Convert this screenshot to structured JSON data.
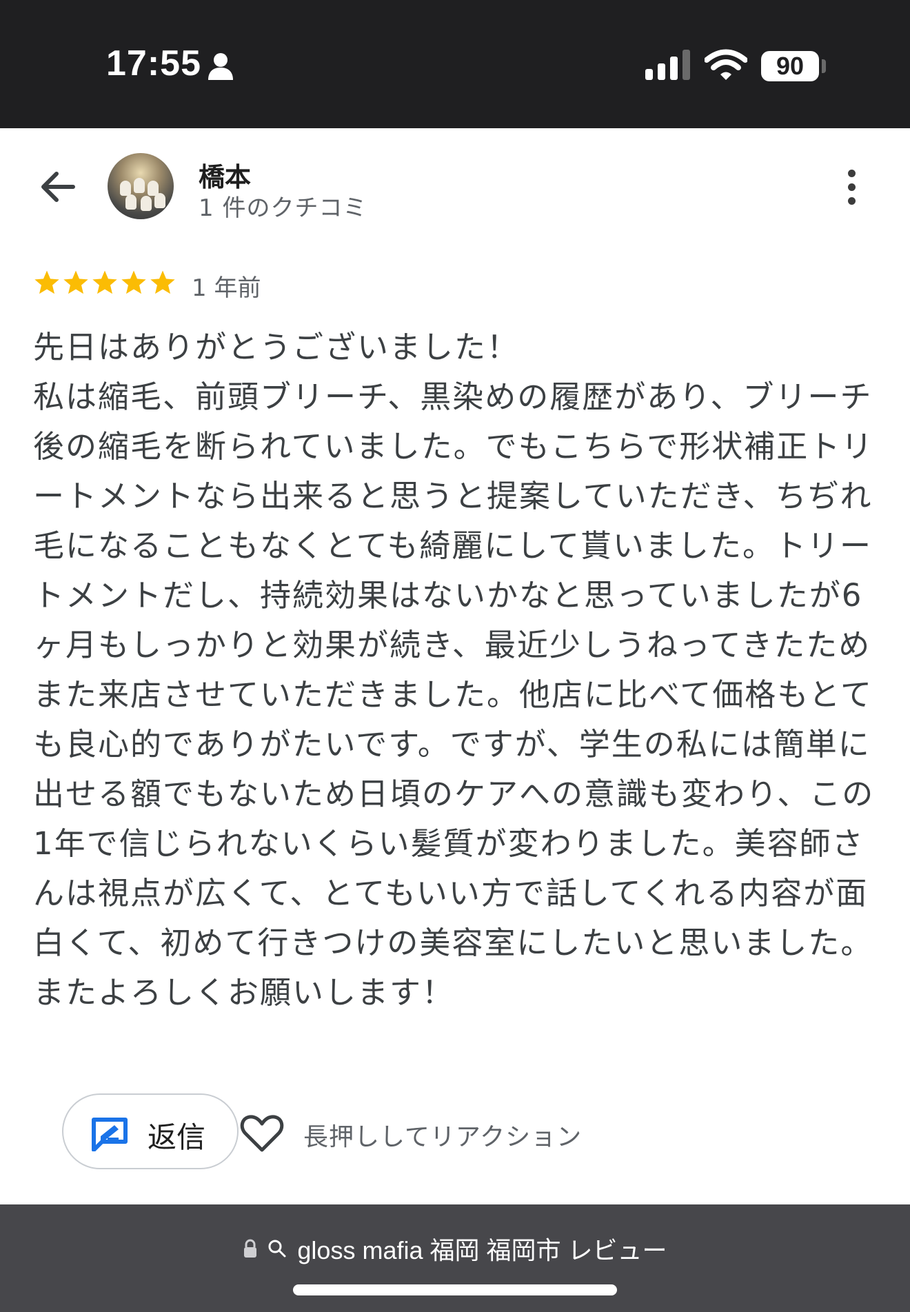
{
  "status_bar": {
    "time": "17:55",
    "battery": "90",
    "icons": [
      "person-icon",
      "signal-icon",
      "wifi-icon",
      "battery-icon"
    ]
  },
  "header": {
    "back_icon": "arrow-left-icon",
    "reviewer_name": "橋本",
    "review_count": "1 件のクチコミ",
    "more_icon": "more-vert-icon"
  },
  "review": {
    "rating": 5,
    "max_rating": 5,
    "star_color": "#fbbc04",
    "time_ago": "1 年前",
    "text": "先日はありがとうございました！\n私は縮毛、前頭ブリーチ、黒染めの履歴があり、ブリーチ後の縮毛を断られていました。でもこちらで形状補正トリートメントなら出来ると思うと提案していただき、ちぢれ毛になることもなくとても綺麗にして貰いました。トリートメントだし、持続効果はないかなと思っていましたが6ヶ月もしっかりと効果が続き、最近少しうねってきたためまた来店させていただきました。他店に比べて価格もとても良心的でありがたいです。ですが、学生の私には簡単に出せる額でもないため日頃のケアへの意識も変わり、この1年で信じられないくらい髪質が変わりました。美容師さんは視点が広くて、とてもいい方で話してくれる内容が面白くて、初めて行きつけの美容室にしたいと思いました。またよろしくお願いします！"
  },
  "actions": {
    "reply_label": "返信",
    "reply_icon": "reply-edit-icon",
    "reply_icon_color": "#1a73e8",
    "heart_icon": "heart-outline-icon",
    "reaction_hint": "長押ししてリアクション"
  },
  "browser_bar": {
    "lock_icon": "lock-icon",
    "search_icon": "search-icon",
    "query": "gloss mafia 福岡 福岡市 レビュー"
  }
}
